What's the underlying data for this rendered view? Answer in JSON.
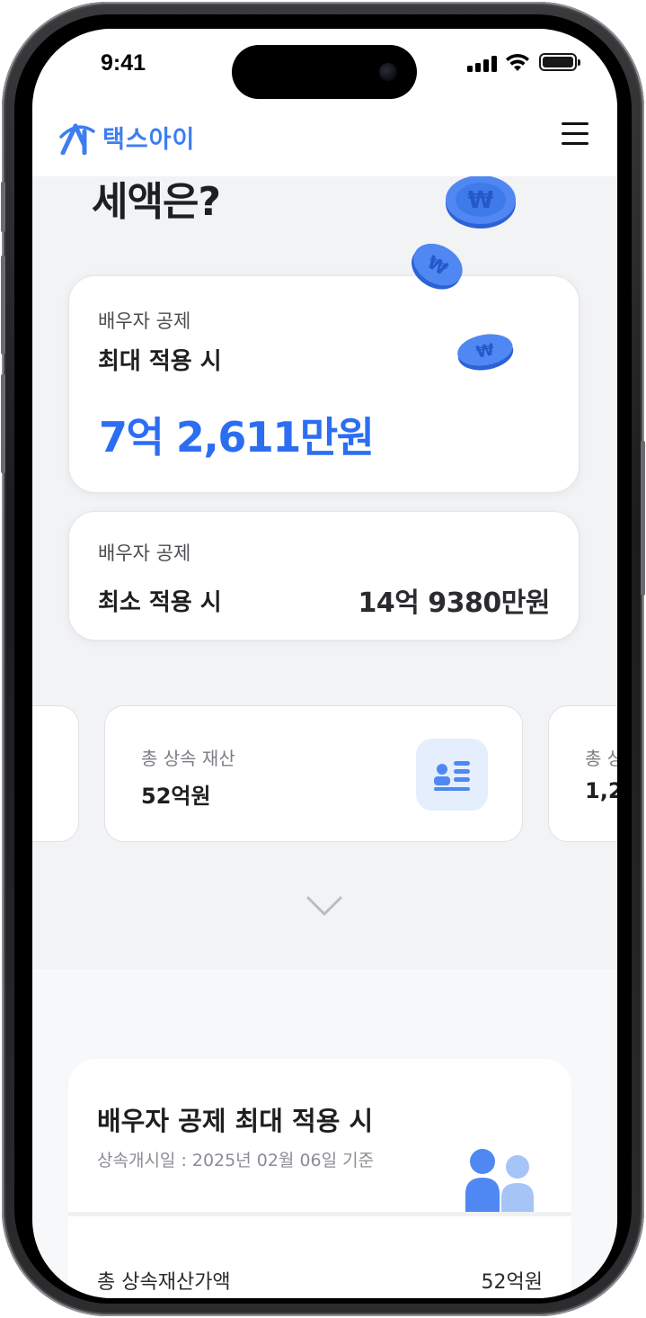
{
  "status_bar": {
    "time": "9:41"
  },
  "app": {
    "brand": "택스아이"
  },
  "hero": {
    "title": "세액은?"
  },
  "max_card": {
    "label": "배우자 공제",
    "title": "최대 적용 시",
    "amount": "7억 2,611만원"
  },
  "min_card": {
    "label": "배우자 공제",
    "title": "최소 적용 시",
    "amount": "14억 9380만원"
  },
  "summary_cards": [
    {
      "label": "총 상속 재산",
      "value": "52억원"
    },
    {
      "label": "총 상",
      "value": "1,2"
    }
  ],
  "detail": {
    "title": "배우자 공제 최대 적용 시",
    "subtitle": "상속개시일 : 2025년 02월 06일 기준",
    "rows": [
      {
        "label": "총 상속재산가액",
        "value": "52억원"
      }
    ]
  },
  "colors": {
    "accent": "#2c6ef2",
    "brand": "#3d7ef0",
    "icon_bg": "#e5eefc"
  },
  "icons": [
    "logo-icon",
    "menu-icon",
    "coin-icon",
    "id-card-icon",
    "chevron-down-icon",
    "people-icon",
    "signal-icon",
    "wifi-icon",
    "battery-icon"
  ]
}
